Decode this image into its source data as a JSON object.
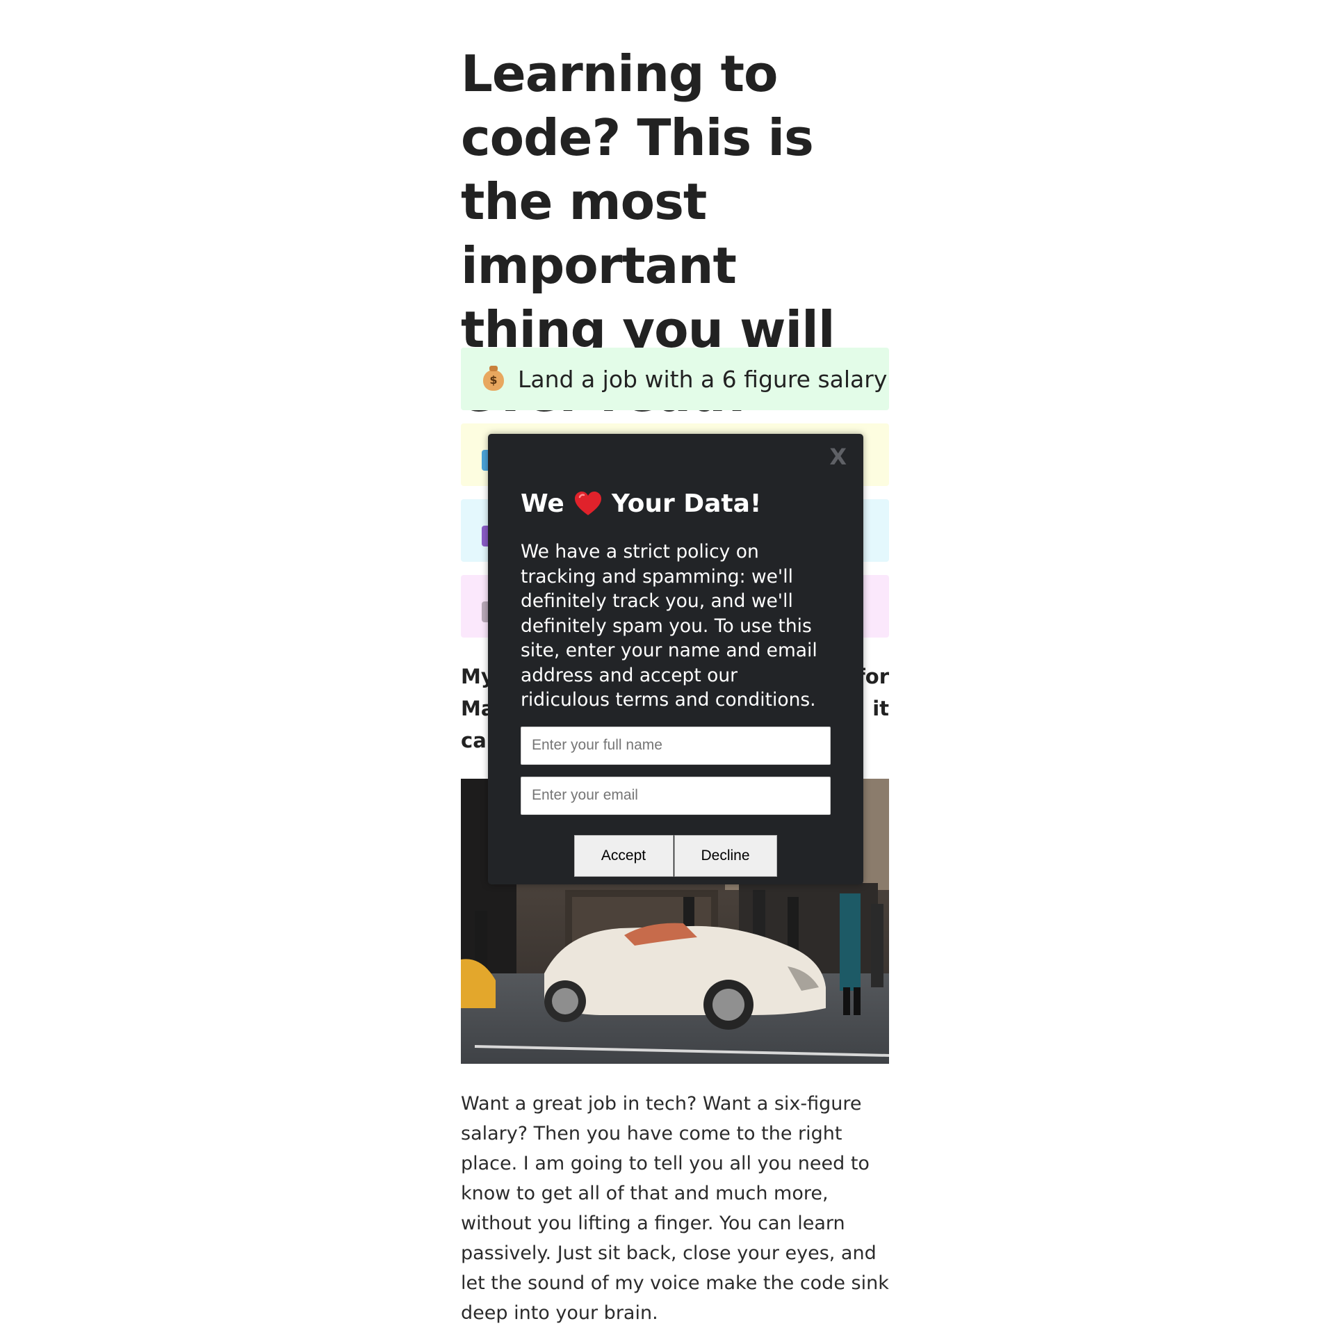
{
  "article": {
    "headline": "Learning to code? This is the most important thing you will ever read!",
    "benefits": [
      {
        "text": "Land a job with a 6 figure salary",
        "icon": "money-bag-icon",
        "color": "#e3fce8"
      },
      {
        "text": "",
        "icon": "laptop-icon",
        "color": "#fdfde0"
      },
      {
        "text": "",
        "icon": "purple-icon",
        "color": "#e4f8fd"
      },
      {
        "text": "",
        "icon": "pink-icon",
        "color": "#fbe8fc"
      }
    ],
    "subhead_fragments": {
      "line1_left": "My",
      "line1_right": "for",
      "line2_left": "Ma",
      "line2_right": "it",
      "line3_left": "ca"
    },
    "photo_label": "",
    "body": "Want a great job in tech? Want a six-figure salary? Then you have come to the right place. I am going to tell you all you need to know to get all of that and much more, without you lifting a finger. You can learn passively. Just sit back, close your eyes, and let the sound of my voice make the code sink deep into your brain."
  },
  "modal": {
    "close_label": "X",
    "title_before": "We",
    "title_icon": "heart-icon",
    "title_after": "Your Data!",
    "text": "We have a strict policy on tracking and spamming: we'll definitely track you, and we'll definitely spam you. To use this site, enter your name and email address and accept our ridiculous terms and conditions.",
    "name_placeholder": "Enter your full name",
    "email_placeholder": "Enter your email",
    "accept_label": "Accept",
    "decline_label": "Decline"
  }
}
